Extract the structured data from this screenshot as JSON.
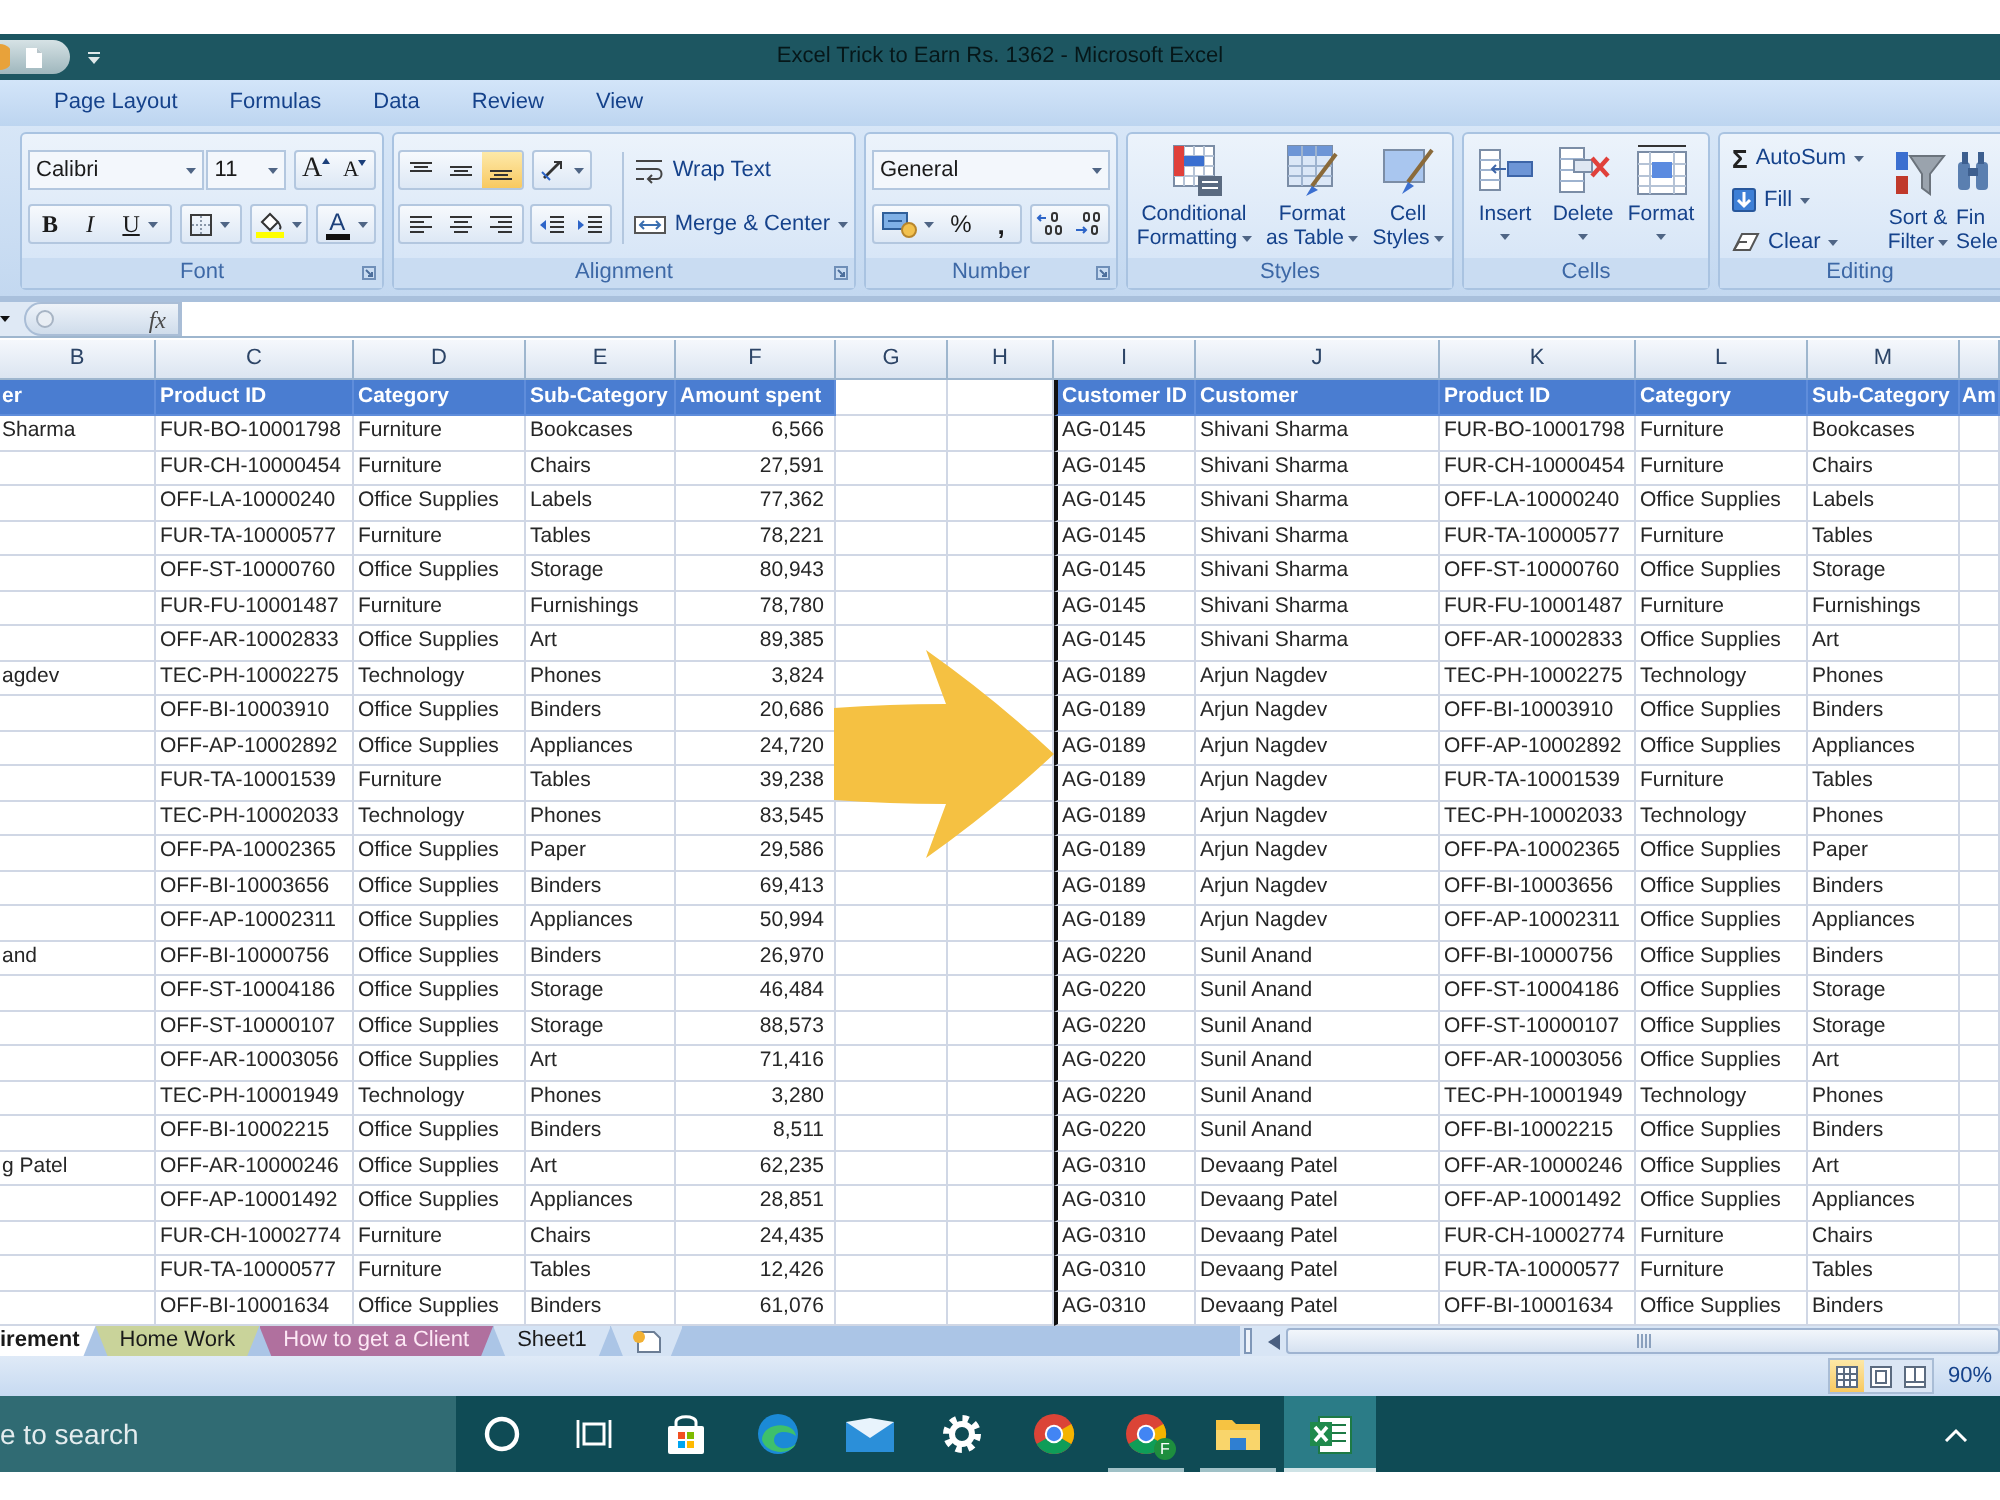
{
  "window": {
    "title": "Excel Trick to Earn Rs. 1362 - Microsoft Excel"
  },
  "ribbon_tabs": [
    {
      "label": "Page Layout",
      "selected": false
    },
    {
      "label": "Formulas",
      "selected": false
    },
    {
      "label": "Data",
      "selected": false
    },
    {
      "label": "Review",
      "selected": false
    },
    {
      "label": "View",
      "selected": false
    }
  ],
  "font_group": {
    "font_name": "Calibri",
    "font_size": "11",
    "grow_font": "A",
    "shrink_font": "A",
    "bold": "B",
    "italic": "I",
    "underline": "U",
    "font_color": "A",
    "label": "Font"
  },
  "alignment_group": {
    "vertical_align": [
      {
        "selected": false
      },
      {
        "selected": false
      },
      {
        "selected": true
      }
    ],
    "wrap_text": "Wrap Text",
    "merge": "Merge & Center",
    "label": "Alignment"
  },
  "number_group": {
    "format": "General",
    "percent": "%",
    "comma": ",",
    "label": "Number"
  },
  "styles_group": {
    "buttons": [
      "Conditional\nFormatting",
      "Format\nas Table",
      "Cell\nStyles"
    ],
    "label": "Styles"
  },
  "cells_group": {
    "buttons": [
      "Insert",
      "Delete",
      "Format"
    ],
    "label": "Cells"
  },
  "editing_group": {
    "autosum_symbol": "Σ",
    "autosum": "AutoSum",
    "fill": "Fill",
    "clear": "Clear",
    "sort_filter": "Sort &\nFilter",
    "find_select": "Fin\nSele",
    "label": "Editing"
  },
  "formula_bar": {
    "function_symbol": "fx"
  },
  "sheet": {
    "column_letters": [
      "B",
      "C",
      "D",
      "E",
      "F",
      "G",
      "H",
      "I",
      "J",
      "K",
      "L",
      "M"
    ],
    "left_table": {
      "columns": [
        "er",
        "Product ID",
        "Category",
        "Sub-Category",
        "Amount spent"
      ],
      "rows": [
        {
          "column_b": "Sharma",
          "product_id": "FUR-BO-10001798",
          "category": "Furniture",
          "sub_category": "Bookcases",
          "amount_spent": "6,566"
        },
        {
          "product_id": "FUR-CH-10000454",
          "category": "Furniture",
          "sub_category": "Chairs",
          "amount_spent": "27,591"
        },
        {
          "product_id": "OFF-LA-10000240",
          "category": "Office Supplies",
          "sub_category": "Labels",
          "amount_spent": "77,362"
        },
        {
          "product_id": "FUR-TA-10000577",
          "category": "Furniture",
          "sub_category": "Tables",
          "amount_spent": "78,221"
        },
        {
          "product_id": "OFF-ST-10000760",
          "category": "Office Supplies",
          "sub_category": "Storage",
          "amount_spent": "80,943"
        },
        {
          "product_id": "FUR-FU-10001487",
          "category": "Furniture",
          "sub_category": "Furnishings",
          "amount_spent": "78,780"
        },
        {
          "product_id": "OFF-AR-10002833",
          "category": "Office Supplies",
          "sub_category": "Art",
          "amount_spent": "89,385"
        },
        {
          "column_b": "agdev",
          "product_id": "TEC-PH-10002275",
          "category": "Technology",
          "sub_category": "Phones",
          "amount_spent": "3,824"
        },
        {
          "product_id": "OFF-BI-10003910",
          "category": "Office Supplies",
          "sub_category": "Binders",
          "amount_spent": "20,686"
        },
        {
          "product_id": "OFF-AP-10002892",
          "category": "Office Supplies",
          "sub_category": "Appliances",
          "amount_spent": "24,720"
        },
        {
          "product_id": "FUR-TA-10001539",
          "category": "Furniture",
          "sub_category": "Tables",
          "amount_spent": "39,238"
        },
        {
          "product_id": "TEC-PH-10002033",
          "category": "Technology",
          "sub_category": "Phones",
          "amount_spent": "83,545"
        },
        {
          "product_id": "OFF-PA-10002365",
          "category": "Office Supplies",
          "sub_category": "Paper",
          "amount_spent": "29,586"
        },
        {
          "product_id": "OFF-BI-10003656",
          "category": "Office Supplies",
          "sub_category": "Binders",
          "amount_spent": "69,413"
        },
        {
          "product_id": "OFF-AP-10002311",
          "category": "Office Supplies",
          "sub_category": "Appliances",
          "amount_spent": "50,994"
        },
        {
          "column_b": "and",
          "product_id": "OFF-BI-10000756",
          "category": "Office Supplies",
          "sub_category": "Binders",
          "amount_spent": "26,970"
        },
        {
          "product_id": "OFF-ST-10004186",
          "category": "Office Supplies",
          "sub_category": "Storage",
          "amount_spent": "46,484"
        },
        {
          "product_id": "OFF-ST-10000107",
          "category": "Office Supplies",
          "sub_category": "Storage",
          "amount_spent": "88,573"
        },
        {
          "product_id": "OFF-AR-10003056",
          "category": "Office Supplies",
          "sub_category": "Art",
          "amount_spent": "71,416"
        },
        {
          "product_id": "TEC-PH-10001949",
          "category": "Technology",
          "sub_category": "Phones",
          "amount_spent": "3,280"
        },
        {
          "product_id": "OFF-BI-10002215",
          "category": "Office Supplies",
          "sub_category": "Binders",
          "amount_spent": "8,511"
        },
        {
          "column_b": "g Patel",
          "product_id": "OFF-AR-10000246",
          "category": "Office Supplies",
          "sub_category": "Art",
          "amount_spent": "62,235"
        },
        {
          "product_id": "OFF-AP-10001492",
          "category": "Office Supplies",
          "sub_category": "Appliances",
          "amount_spent": "28,851"
        },
        {
          "product_id": "FUR-CH-10002774",
          "category": "Furniture",
          "sub_category": "Chairs",
          "amount_spent": "24,435"
        },
        {
          "product_id": "FUR-TA-10000577",
          "category": "Furniture",
          "sub_category": "Tables",
          "amount_spent": "12,426"
        },
        {
          "product_id": "OFF-BI-10001634",
          "category": "Office Supplies",
          "sub_category": "Binders",
          "amount_spent": "61,076"
        }
      ]
    },
    "right_table": {
      "columns": [
        "Customer ID",
        "Customer",
        "Product ID",
        "Category",
        "Sub-Category",
        "Am"
      ],
      "rows": [
        {
          "customer_id": "AG-0145",
          "customer": "Shivani Sharma",
          "product_id": "FUR-BO-10001798",
          "category": "Furniture",
          "sub_category": "Bookcases"
        },
        {
          "customer_id": "AG-0145",
          "customer": "Shivani Sharma",
          "product_id": "FUR-CH-10000454",
          "category": "Furniture",
          "sub_category": "Chairs"
        },
        {
          "customer_id": "AG-0145",
          "customer": "Shivani Sharma",
          "product_id": "OFF-LA-10000240",
          "category": "Office Supplies",
          "sub_category": "Labels"
        },
        {
          "customer_id": "AG-0145",
          "customer": "Shivani Sharma",
          "product_id": "FUR-TA-10000577",
          "category": "Furniture",
          "sub_category": "Tables"
        },
        {
          "customer_id": "AG-0145",
          "customer": "Shivani Sharma",
          "product_id": "OFF-ST-10000760",
          "category": "Office Supplies",
          "sub_category": "Storage"
        },
        {
          "customer_id": "AG-0145",
          "customer": "Shivani Sharma",
          "product_id": "FUR-FU-10001487",
          "category": "Furniture",
          "sub_category": "Furnishings"
        },
        {
          "customer_id": "AG-0145",
          "customer": "Shivani Sharma",
          "product_id": "OFF-AR-10002833",
          "category": "Office Supplies",
          "sub_category": "Art"
        },
        {
          "customer_id": "AG-0189",
          "customer": "Arjun Nagdev",
          "product_id": "TEC-PH-10002275",
          "category": "Technology",
          "sub_category": "Phones"
        },
        {
          "customer_id": "AG-0189",
          "customer": "Arjun Nagdev",
          "product_id": "OFF-BI-10003910",
          "category": "Office Supplies",
          "sub_category": "Binders"
        },
        {
          "customer_id": "AG-0189",
          "customer": "Arjun Nagdev",
          "product_id": "OFF-AP-10002892",
          "category": "Office Supplies",
          "sub_category": "Appliances"
        },
        {
          "customer_id": "AG-0189",
          "customer": "Arjun Nagdev",
          "product_id": "FUR-TA-10001539",
          "category": "Furniture",
          "sub_category": "Tables"
        },
        {
          "customer_id": "AG-0189",
          "customer": "Arjun Nagdev",
          "product_id": "TEC-PH-10002033",
          "category": "Technology",
          "sub_category": "Phones"
        },
        {
          "customer_id": "AG-0189",
          "customer": "Arjun Nagdev",
          "product_id": "OFF-PA-10002365",
          "category": "Office Supplies",
          "sub_category": "Paper"
        },
        {
          "customer_id": "AG-0189",
          "customer": "Arjun Nagdev",
          "product_id": "OFF-BI-10003656",
          "category": "Office Supplies",
          "sub_category": "Binders"
        },
        {
          "customer_id": "AG-0189",
          "customer": "Arjun Nagdev",
          "product_id": "OFF-AP-10002311",
          "category": "Office Supplies",
          "sub_category": "Appliances"
        },
        {
          "customer_id": "AG-0220",
          "customer": "Sunil Anand",
          "product_id": "OFF-BI-10000756",
          "category": "Office Supplies",
          "sub_category": "Binders"
        },
        {
          "customer_id": "AG-0220",
          "customer": "Sunil Anand",
          "product_id": "OFF-ST-10004186",
          "category": "Office Supplies",
          "sub_category": "Storage"
        },
        {
          "customer_id": "AG-0220",
          "customer": "Sunil Anand",
          "product_id": "OFF-ST-10000107",
          "category": "Office Supplies",
          "sub_category": "Storage"
        },
        {
          "customer_id": "AG-0220",
          "customer": "Sunil Anand",
          "product_id": "OFF-AR-10003056",
          "category": "Office Supplies",
          "sub_category": "Art"
        },
        {
          "customer_id": "AG-0220",
          "customer": "Sunil Anand",
          "product_id": "TEC-PH-10001949",
          "category": "Technology",
          "sub_category": "Phones"
        },
        {
          "customer_id": "AG-0220",
          "customer": "Sunil Anand",
          "product_id": "OFF-BI-10002215",
          "category": "Office Supplies",
          "sub_category": "Binders"
        },
        {
          "customer_id": "AG-0310",
          "customer": "Devaang Patel",
          "product_id": "OFF-AR-10000246",
          "category": "Office Supplies",
          "sub_category": "Art"
        },
        {
          "customer_id": "AG-0310",
          "customer": "Devaang Patel",
          "product_id": "OFF-AP-10001492",
          "category": "Office Supplies",
          "sub_category": "Appliances"
        },
        {
          "customer_id": "AG-0310",
          "customer": "Devaang Patel",
          "product_id": "FUR-CH-10002774",
          "category": "Furniture",
          "sub_category": "Chairs"
        },
        {
          "customer_id": "AG-0310",
          "customer": "Devaang Patel",
          "product_id": "FUR-TA-10000577",
          "category": "Furniture",
          "sub_category": "Tables"
        },
        {
          "customer_id": "AG-0310",
          "customer": "Devaang Patel",
          "product_id": "OFF-BI-10001634",
          "category": "Office Supplies",
          "sub_category": "Binders"
        }
      ]
    }
  },
  "sheet_tabs": [
    {
      "label": "irement",
      "selected": true
    },
    {
      "label": "Home Work",
      "selected": false,
      "color": "#c9d39a"
    },
    {
      "label": "How to get a Client",
      "selected": false,
      "color": "#b0709e"
    },
    {
      "label": "Sheet1",
      "selected": false
    }
  ],
  "status_bar": {
    "views": [
      {
        "selected": true
      },
      {
        "selected": false
      },
      {
        "selected": false
      }
    ],
    "zoom": "90%"
  },
  "taskbar": {
    "search": {
      "placeholder": "e to search"
    },
    "apps": [
      {
        "running": false,
        "selected": false
      },
      {
        "running": false,
        "selected": false
      },
      {
        "running": false,
        "selected": false
      },
      {
        "running": false,
        "selected": false
      },
      {
        "running": false,
        "selected": false
      },
      {
        "running": false,
        "selected": false
      },
      {
        "running": false,
        "selected": false
      },
      {
        "running": true,
        "selected": false,
        "badge": "F"
      },
      {
        "running": true,
        "selected": false
      },
      {
        "running": true,
        "selected": true
      }
    ]
  }
}
